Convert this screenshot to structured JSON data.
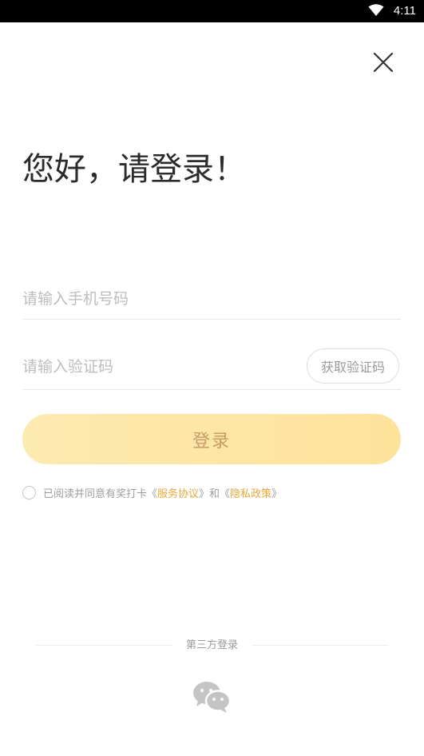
{
  "status_bar": {
    "time": "4:11"
  },
  "login": {
    "title": "您好，请登录！",
    "phone_placeholder": "请输入手机号码",
    "code_placeholder": "请输入验证码",
    "get_code_label": "获取验证码",
    "submit_label": "登录"
  },
  "agreement": {
    "prefix": "已阅读并同意有奖打卡《",
    "terms_link": "服务协议",
    "middle": "》和《",
    "privacy_link": "隐私政策",
    "suffix": "》",
    "accent_color": "#e8a93a"
  },
  "third_party": {
    "label": "第三方登录",
    "providers": [
      "wechat-icon"
    ]
  },
  "icons": {
    "close": "close-icon",
    "wifi": "wifi-icon"
  },
  "colors": {
    "button_gradient_start": "#fdeab1",
    "button_gradient_end": "#fde29a",
    "button_text": "#c79c6a"
  }
}
